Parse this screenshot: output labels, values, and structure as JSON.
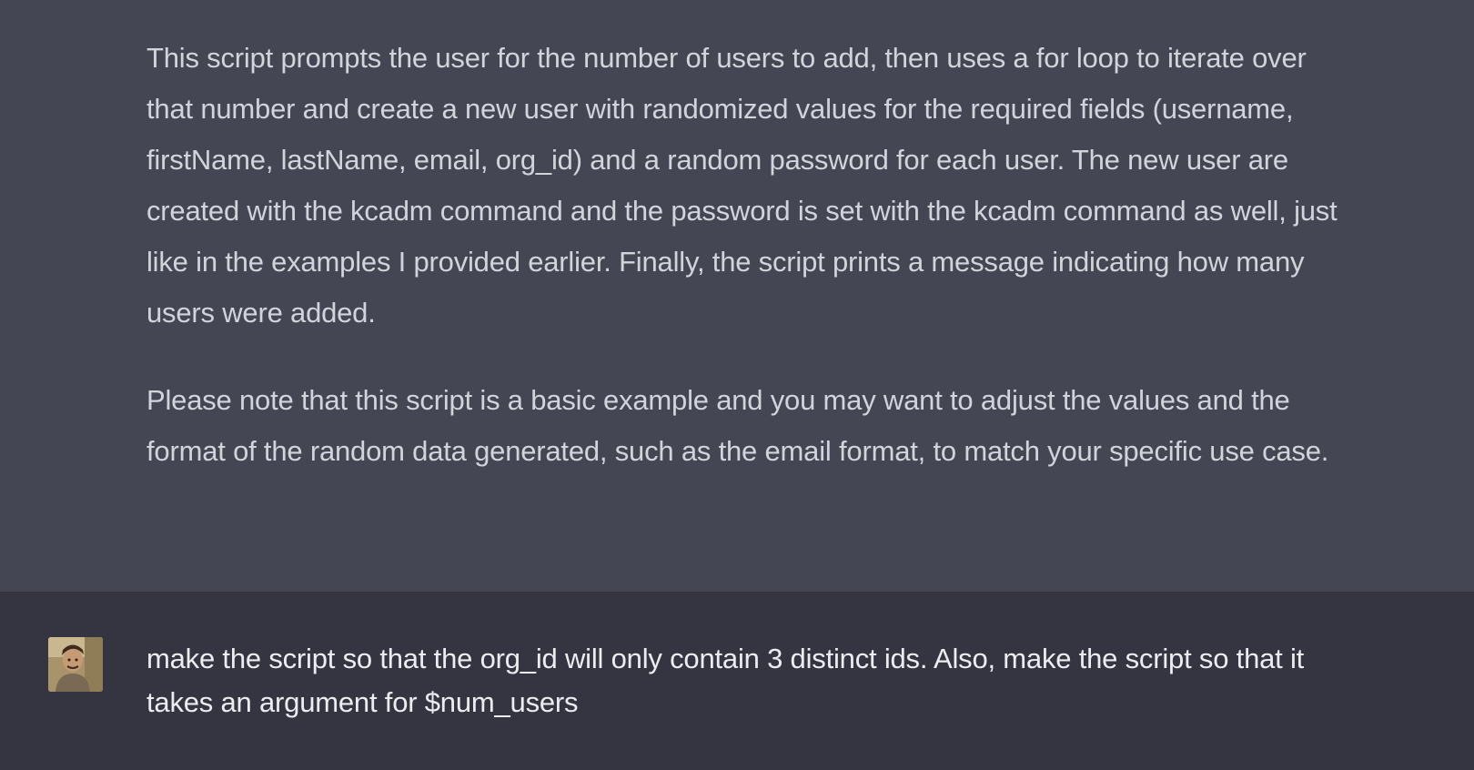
{
  "assistant_message": {
    "paragraphs": [
      "This script prompts the user for the number of users to add, then uses a for loop to iterate over that number and create a new user with randomized values for the required fields (username, firstName, lastName, email, org_id) and a random password for each user. The new user are created with the kcadm command and the password is set with the kcadm command as well, just like in the examples I provided earlier. Finally, the script prints a message indicating how many users were added.",
      "Please note that this script is a basic example and you may want to adjust the values and the format of the random data generated, such as the email format, to match your specific use case."
    ]
  },
  "user_message": {
    "avatar_icon": "user-avatar",
    "text": "make the script so that the org_id will only contain 3 distinct ids. Also, make the script so that it takes an argument for $num_users"
  },
  "colors": {
    "assistant_bg": "#444654",
    "user_bg": "#343541",
    "assistant_text": "#d1d5db",
    "user_text": "#ececf1"
  }
}
